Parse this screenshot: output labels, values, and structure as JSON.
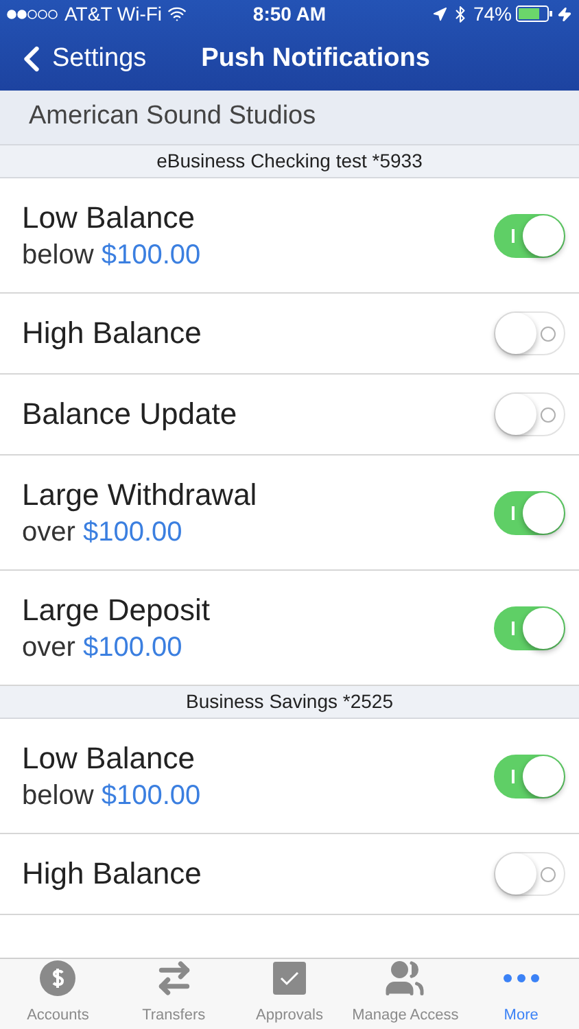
{
  "status_bar": {
    "carrier": "AT&T Wi-Fi",
    "time": "8:50 AM",
    "battery": "74%"
  },
  "nav": {
    "back": "Settings",
    "title": "Push Notifications"
  },
  "company": "American Sound Studios",
  "sections": [
    {
      "title": "eBusiness Checking test *5933",
      "rows": [
        {
          "title": "Low Balance",
          "prefix": "below",
          "amount": "$100.00",
          "on": true
        },
        {
          "title": "High Balance",
          "on": false
        },
        {
          "title": "Balance Update",
          "on": false
        },
        {
          "title": "Large Withdrawal",
          "prefix": "over",
          "amount": "$100.00",
          "on": true
        },
        {
          "title": "Large Deposit",
          "prefix": "over",
          "amount": "$100.00",
          "on": true
        }
      ]
    },
    {
      "title": "Business Savings *2525",
      "rows": [
        {
          "title": "Low Balance",
          "prefix": "below",
          "amount": "$100.00",
          "on": true
        },
        {
          "title": "High Balance",
          "on": false
        }
      ]
    }
  ],
  "tab_bar": [
    {
      "label": "Accounts",
      "kind": "dollar",
      "selected": false
    },
    {
      "label": "Transfers",
      "kind": "arrows",
      "selected": false
    },
    {
      "label": "Approvals",
      "kind": "check",
      "selected": false
    },
    {
      "label": "Manage Access",
      "kind": "users",
      "selected": false
    },
    {
      "label": "More",
      "kind": "more",
      "selected": true
    }
  ]
}
